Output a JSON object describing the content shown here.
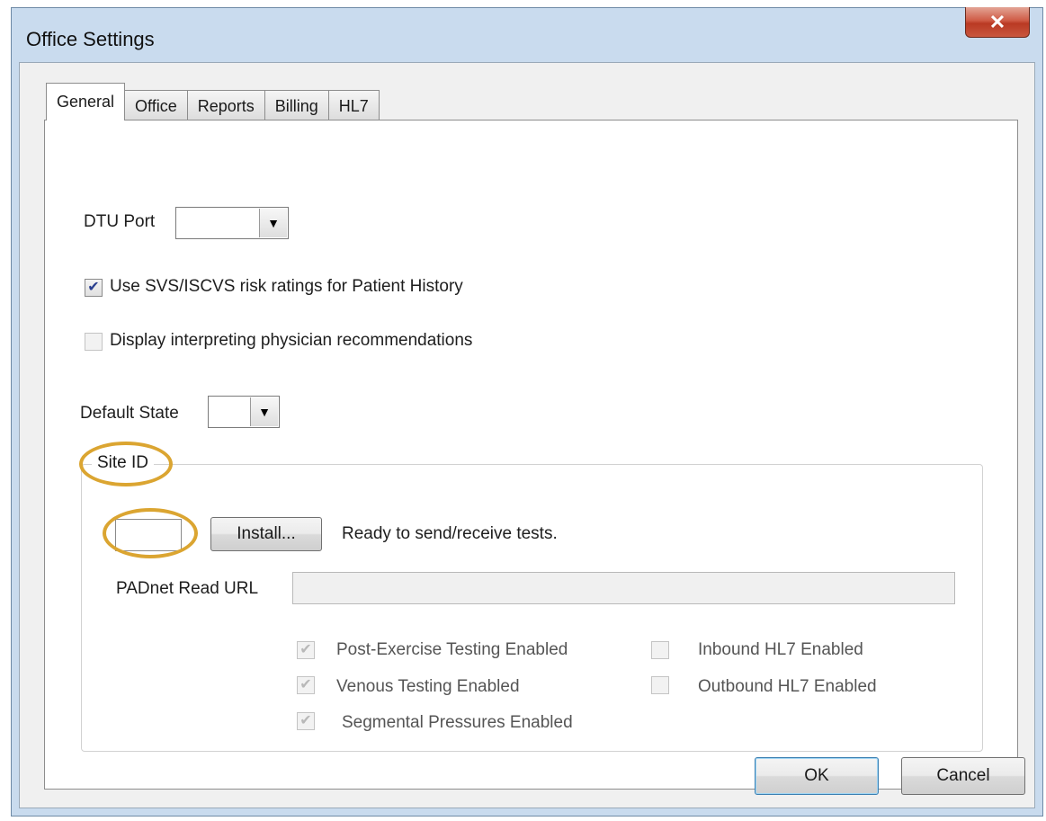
{
  "window": {
    "title": "Office Settings",
    "close_glyph": "✕"
  },
  "tabs": [
    {
      "label": "General",
      "active": true
    },
    {
      "label": "Office",
      "active": false
    },
    {
      "label": "Reports",
      "active": false
    },
    {
      "label": "Billing",
      "active": false
    },
    {
      "label": "HL7",
      "active": false
    }
  ],
  "general": {
    "dtu_port_label": "DTU Port",
    "dtu_port_value": "",
    "use_svs": {
      "label": "Use SVS/ISCVS risk ratings for Patient History",
      "checked": true
    },
    "display_interpreting": {
      "label": "Display interpreting physician recommendations",
      "checked": false,
      "enabled": false
    },
    "default_state_label": "Default State",
    "default_state_value": "",
    "site_id": {
      "group_title": "Site ID",
      "site_id_value": "",
      "install_label": "Install...",
      "status_text": "Ready to send/receive tests.",
      "padnet_label": "PADnet Read URL",
      "padnet_value": "",
      "features": {
        "post_exercise": {
          "label": "Post-Exercise Testing Enabled",
          "checked": true
        },
        "venous": {
          "label": "Venous Testing Enabled",
          "checked": true
        },
        "segmental": {
          "label": "Segmental Pressures Enabled",
          "checked": true
        },
        "inbound_hl7": {
          "label": "Inbound HL7 Enabled",
          "checked": false
        },
        "outbound_hl7": {
          "label": "Outbound HL7 Enabled",
          "checked": false
        }
      }
    }
  },
  "footer": {
    "ok_label": "OK",
    "cancel_label": "Cancel"
  },
  "colors": {
    "highlight_ring": "#dba531",
    "close_button": "#c9573f"
  },
  "icons": {
    "dropdown": "chevron-down-icon",
    "check": "checkmark-icon"
  }
}
